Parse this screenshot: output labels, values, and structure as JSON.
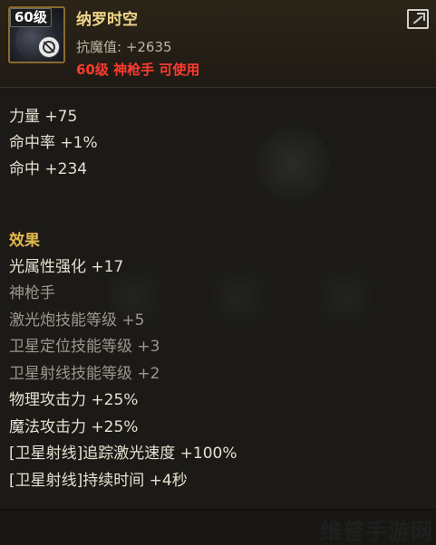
{
  "header": {
    "level_badge": "60级",
    "item_name": "纳罗时空",
    "stat_line": "抗魔值: +2635",
    "requirement": "60级 神枪手 可使用"
  },
  "icons": {
    "share": "share-icon",
    "unusable": "ban-icon"
  },
  "stats": [
    "力量 +75",
    "命中率 +1%",
    "命中 +234"
  ],
  "effects": {
    "title": "效果",
    "lines": [
      "光属性强化 +17",
      "神枪手",
      "激光炮技能等级 +5",
      "卫星定位技能等级 +3",
      "卫星射线技能等级 +2",
      "物理攻击力 +25%",
      "魔法攻击力 +25%",
      "[卫星射线]追踪激光速度 +100%",
      "[卫星射线]持续时间 +4秒"
    ]
  },
  "watermark": "维普手游网",
  "colors": {
    "item_name": "#f0d78c",
    "requirement": "#ff3b2f",
    "section_title": "#e3b94f",
    "text": "#e6e0d0"
  }
}
